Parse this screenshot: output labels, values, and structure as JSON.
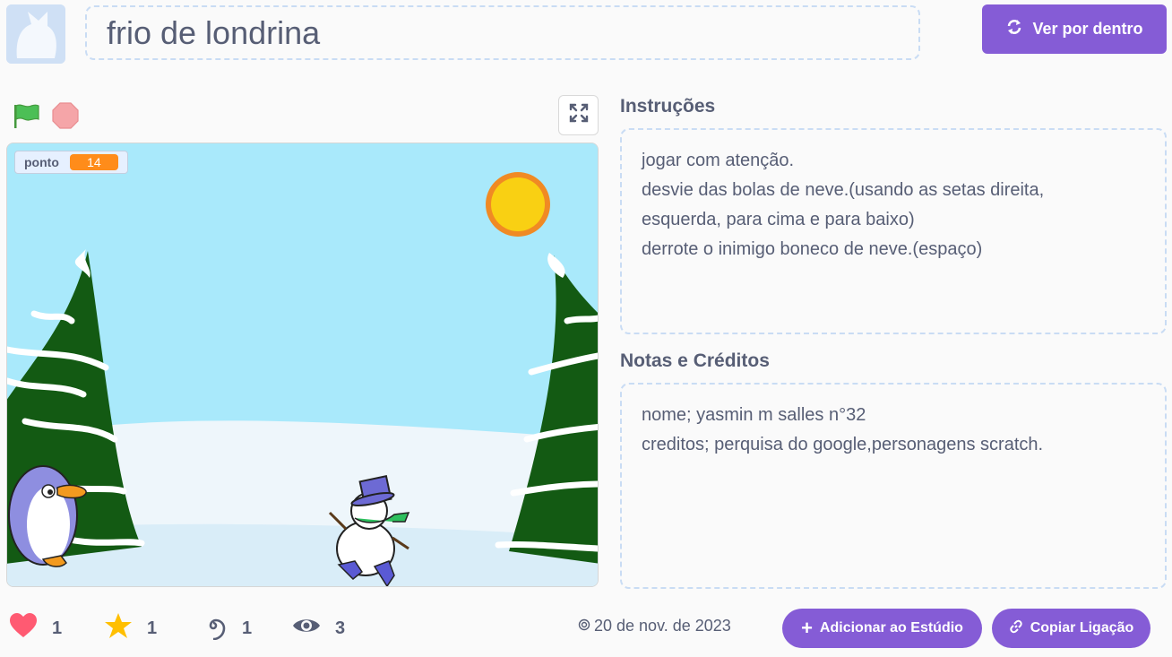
{
  "project": {
    "title": "frio de londrina",
    "see_inside_label": "Ver por dentro"
  },
  "stage": {
    "monitor_label": "ponto",
    "monitor_value": "14"
  },
  "instructions": {
    "heading": "Instruções",
    "lines": [
      "jogar com atenção.",
      "desvie das bolas de neve.(usando as setas direita,",
      "esquerda, para cima e para baixo)",
      "derrote o inimigo boneco de neve.(espaço)"
    ]
  },
  "notes": {
    "heading": "Notas e Créditos",
    "lines": [
      "nome; yasmin m salles n°32",
      "creditos; perquisa do google,personagens scratch."
    ]
  },
  "stats": {
    "loves": "1",
    "favorites": "1",
    "remixes": "1",
    "views": "3"
  },
  "date": "20 de nov. de 2023",
  "actions": {
    "add_to_studio": "Adicionar ao Estúdio",
    "copy_link": "Copiar Ligação"
  },
  "colors": {
    "accent": "#855cd6",
    "monitor_value": "#ff8c1a",
    "sky": "#a9e9fb"
  },
  "icons": {
    "green_flag": "green-flag-icon",
    "stop": "stop-icon",
    "fullscreen": "fullscreen-icon",
    "heart": "heart-icon",
    "star": "star-icon",
    "remix": "remix-icon",
    "eye": "eye-icon"
  }
}
